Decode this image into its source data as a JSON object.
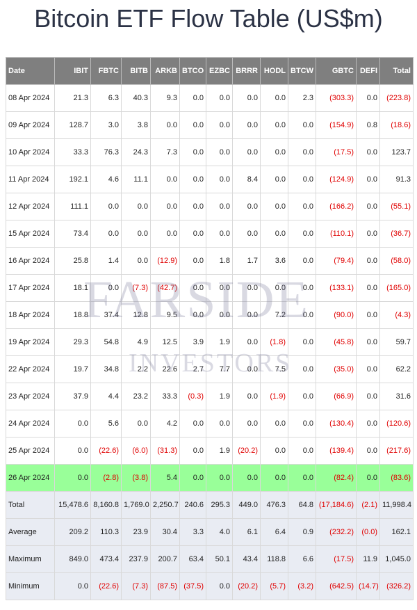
{
  "title": "Bitcoin ETF Flow Table (US$m)",
  "watermark": {
    "line1": "FARSIDE",
    "line2": "INVESTORS"
  },
  "columns": [
    "Date",
    "IBIT",
    "FBTC",
    "BITB",
    "ARKB",
    "BTCO",
    "EZBC",
    "BRRR",
    "HODL",
    "BTCW",
    "GBTC",
    "DEFI",
    "Total"
  ],
  "rows": [
    [
      "08 Apr 2024",
      "21.3",
      "6.3",
      "40.3",
      "9.3",
      "0.0",
      "0.0",
      "0.0",
      "0.0",
      "2.3",
      "(303.3)",
      "0.0",
      "(223.8)"
    ],
    [
      "09 Apr 2024",
      "128.7",
      "3.0",
      "3.8",
      "0.0",
      "0.0",
      "0.0",
      "0.0",
      "0.0",
      "0.0",
      "(154.9)",
      "0.8",
      "(18.6)"
    ],
    [
      "10 Apr 2024",
      "33.3",
      "76.3",
      "24.3",
      "7.3",
      "0.0",
      "0.0",
      "0.0",
      "0.0",
      "0.0",
      "(17.5)",
      "0.0",
      "123.7"
    ],
    [
      "11 Apr 2024",
      "192.1",
      "4.6",
      "11.1",
      "0.0",
      "0.0",
      "0.0",
      "8.4",
      "0.0",
      "0.0",
      "(124.9)",
      "0.0",
      "91.3"
    ],
    [
      "12 Apr 2024",
      "111.1",
      "0.0",
      "0.0",
      "0.0",
      "0.0",
      "0.0",
      "0.0",
      "0.0",
      "0.0",
      "(166.2)",
      "0.0",
      "(55.1)"
    ],
    [
      "15 Apr 2024",
      "73.4",
      "0.0",
      "0.0",
      "0.0",
      "0.0",
      "0.0",
      "0.0",
      "0.0",
      "0.0",
      "(110.1)",
      "0.0",
      "(36.7)"
    ],
    [
      "16 Apr 2024",
      "25.8",
      "1.4",
      "0.0",
      "(12.9)",
      "0.0",
      "1.8",
      "1.7",
      "3.6",
      "0.0",
      "(79.4)",
      "0.0",
      "(58.0)"
    ],
    [
      "17 Apr 2024",
      "18.1",
      "0.0",
      "(7.3)",
      "(42.7)",
      "0.0",
      "0.0",
      "0.0",
      "0.0",
      "0.0",
      "(133.1)",
      "0.0",
      "(165.0)"
    ],
    [
      "18 Apr 2024",
      "18.8",
      "37.4",
      "12.8",
      "9.5",
      "0.0",
      "0.0",
      "0.0",
      "7.2",
      "0.0",
      "(90.0)",
      "0.0",
      "(4.3)"
    ],
    [
      "19 Apr 2024",
      "29.3",
      "54.8",
      "4.9",
      "12.5",
      "3.9",
      "1.9",
      "0.0",
      "(1.8)",
      "0.0",
      "(45.8)",
      "0.0",
      "59.7"
    ],
    [
      "22 Apr 2024",
      "19.7",
      "34.8",
      "2.2",
      "22.6",
      "2.7",
      "7.7",
      "0.0",
      "7.5",
      "0.0",
      "(35.0)",
      "0.0",
      "62.2"
    ],
    [
      "23 Apr 2024",
      "37.9",
      "4.4",
      "23.2",
      "33.3",
      "(0.3)",
      "1.9",
      "0.0",
      "(1.9)",
      "0.0",
      "(66.9)",
      "0.0",
      "31.6"
    ],
    [
      "24 Apr 2024",
      "0.0",
      "5.6",
      "0.0",
      "4.2",
      "0.0",
      "0.0",
      "0.0",
      "0.0",
      "0.0",
      "(130.4)",
      "0.0",
      "(120.6)"
    ],
    [
      "25 Apr 2024",
      "0.0",
      "(22.6)",
      "(6.0)",
      "(31.3)",
      "0.0",
      "1.9",
      "(20.2)",
      "0.0",
      "0.0",
      "(139.4)",
      "0.0",
      "(217.6)"
    ],
    [
      "26 Apr 2024",
      "0.0",
      "(2.8)",
      "(3.8)",
      "5.4",
      "0.0",
      "0.0",
      "0.0",
      "0.0",
      "0.0",
      "(82.4)",
      "0.0",
      "(83.6)"
    ]
  ],
  "highlight_row_index": 14,
  "summary_rows": [
    [
      "Total",
      "15,478.6",
      "8,160.8",
      "1,769.0",
      "2,250.7",
      "240.6",
      "295.3",
      "449.0",
      "476.3",
      "64.8",
      "(17,184.6)",
      "(2.1)",
      "11,998.4"
    ],
    [
      "Average",
      "209.2",
      "110.3",
      "23.9",
      "30.4",
      "3.3",
      "4.0",
      "6.1",
      "6.4",
      "0.9",
      "(232.2)",
      "(0.0)",
      "162.1"
    ],
    [
      "Maximum",
      "849.0",
      "473.4",
      "237.9",
      "200.7",
      "63.4",
      "50.1",
      "43.4",
      "118.8",
      "6.6",
      "(17.5)",
      "11.9",
      "1,045.0"
    ],
    [
      "Minimum",
      "0.0",
      "(22.6)",
      "(7.3)",
      "(87.5)",
      "(37.5)",
      "0.0",
      "(20.2)",
      "(5.7)",
      "(3.2)",
      "(642.5)",
      "(14.7)",
      "(326.2)"
    ]
  ],
  "colors": {
    "header_bg": "#7f7f7f",
    "negative": "#e00000",
    "highlight": "#99ff99",
    "summary_bg": "#e9ecf3"
  }
}
